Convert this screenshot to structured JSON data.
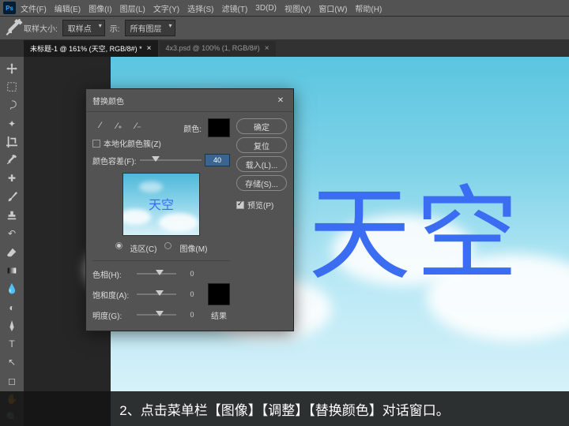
{
  "app_logo": "Ps",
  "menu": [
    "文件(F)",
    "编辑(E)",
    "图像(I)",
    "图层(L)",
    "文字(Y)",
    "选择(S)",
    "滤镜(T)",
    "3D(D)",
    "视图(V)",
    "窗口(W)",
    "帮助(H)"
  ],
  "optbar": {
    "sample_label": "取样大小:",
    "sample_value": "取样点",
    "show_label": "示:",
    "show_value": "所有图层"
  },
  "tabs": [
    {
      "label": "未标题-1 @ 161% (天空, RGB/8#) *",
      "active": true
    },
    {
      "label": "4x3.psd @ 100% (1, RGB/8#)",
      "active": false
    }
  ],
  "sky_text": "天空",
  "dialog": {
    "title": "替换颜色",
    "localized": "本地化颜色簇(Z)",
    "color_label": "颜色:",
    "fuzziness_label": "颜色容差(F):",
    "fuzziness_value": "40",
    "selection": "选区(C)",
    "image": "图像(M)",
    "hue_label": "色相(H):",
    "hue_value": "0",
    "sat_label": "饱和度(A):",
    "sat_value": "0",
    "light_label": "明度(G):",
    "light_value": "0",
    "result_label": "结果",
    "preview_text": "天空",
    "buttons": {
      "ok": "确定",
      "cancel": "复位",
      "load": "载入(L)...",
      "save": "存储(S)..."
    },
    "preview_chk": "预览(P)"
  },
  "caption": "2、点击菜单栏【图像】【调整】【替换颜色】对话窗口。"
}
